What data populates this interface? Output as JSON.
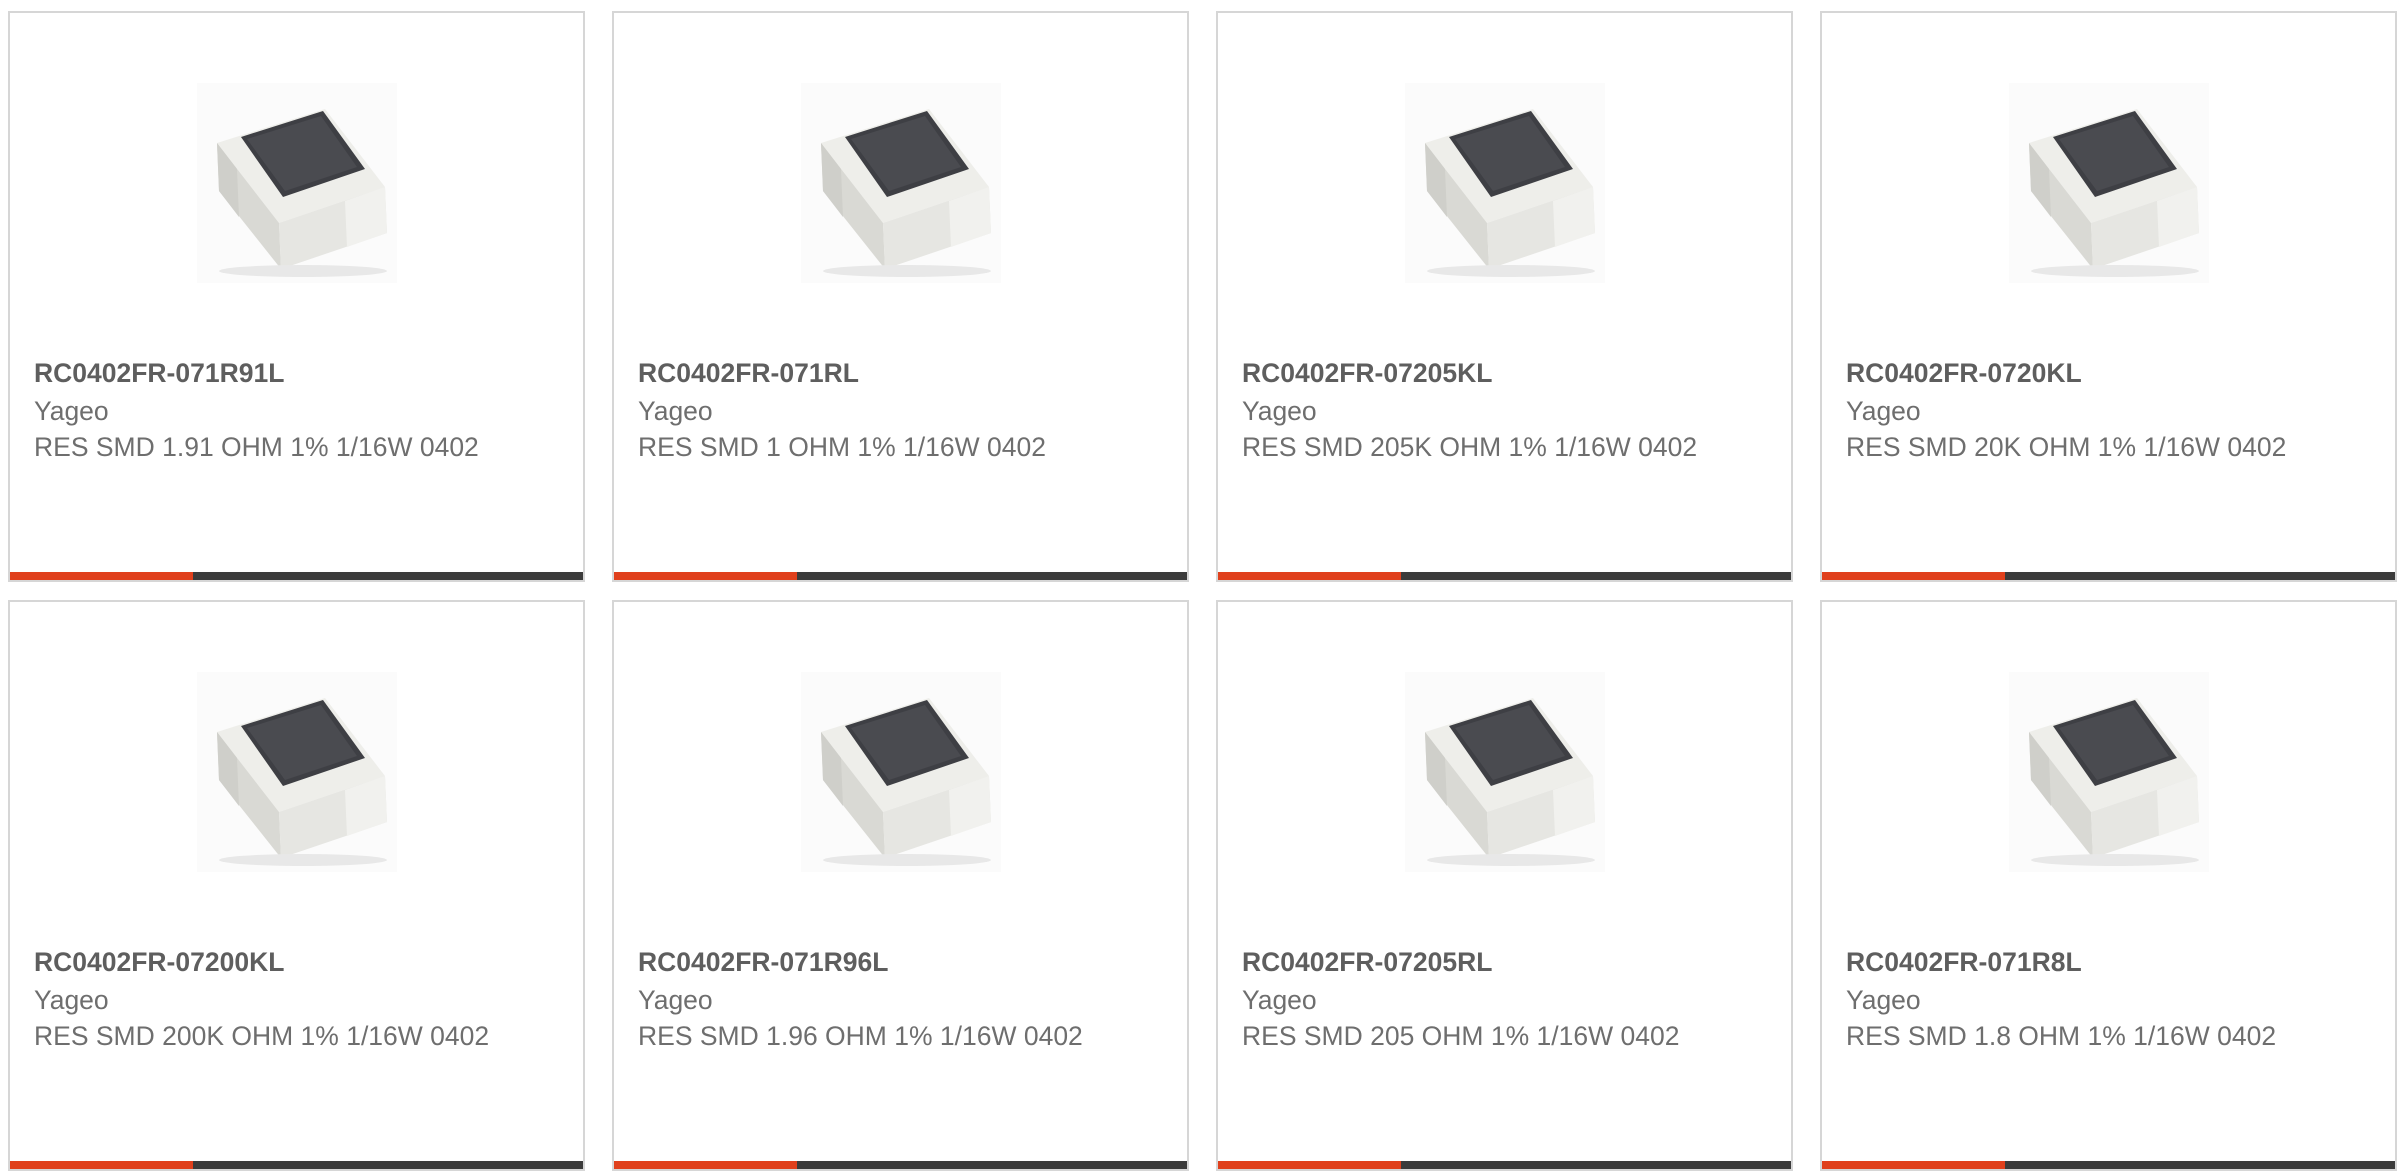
{
  "products": [
    {
      "part_number": "RC0402FR-071R91L",
      "manufacturer": "Yageo",
      "description": "RES SMD 1.91 OHM 1% 1/16W 0402"
    },
    {
      "part_number": "RC0402FR-071RL",
      "manufacturer": "Yageo",
      "description": "RES SMD 1 OHM 1% 1/16W 0402"
    },
    {
      "part_number": "RC0402FR-07205KL",
      "manufacturer": "Yageo",
      "description": "RES SMD 205K OHM 1% 1/16W 0402"
    },
    {
      "part_number": "RC0402FR-0720KL",
      "manufacturer": "Yageo",
      "description": "RES SMD 20K OHM 1% 1/16W 0402"
    },
    {
      "part_number": "RC0402FR-07200KL",
      "manufacturer": "Yageo",
      "description": "RES SMD 200K OHM 1% 1/16W 0402"
    },
    {
      "part_number": "RC0402FR-071R96L",
      "manufacturer": "Yageo",
      "description": "RES SMD 1.96 OHM 1% 1/16W 0402"
    },
    {
      "part_number": "RC0402FR-07205RL",
      "manufacturer": "Yageo",
      "description": "RES SMD 205 OHM 1% 1/16W 0402"
    },
    {
      "part_number": "RC0402FR-071R8L",
      "manufacturer": "Yageo",
      "description": "RES SMD 1.8 OHM 1% 1/16W 0402"
    }
  ],
  "colors": {
    "accent": "#e0401c",
    "bar": "#3b3b3b",
    "border": "#d6d6d6",
    "text": "#6e6e6e"
  },
  "icons": {
    "product_image": "smd-resistor-chip-image"
  }
}
